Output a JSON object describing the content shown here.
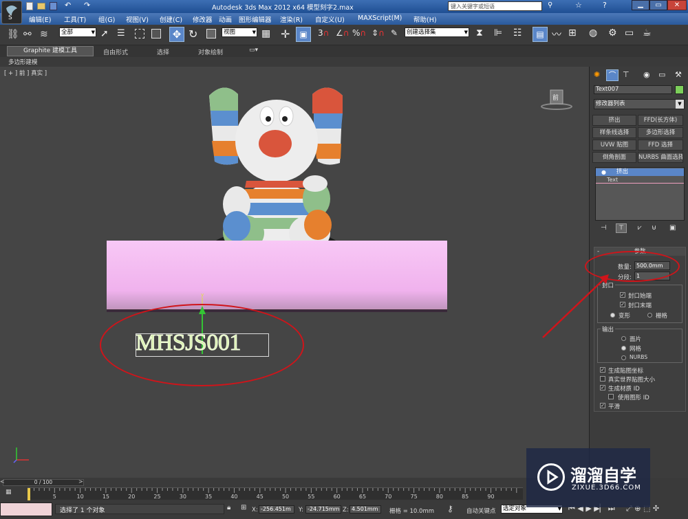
{
  "titlebar": {
    "title": "Autodesk 3ds Max  2012 x64    模型刻字2.max",
    "search_placeholder": "键入关键字或短语"
  },
  "menu": [
    "编辑(E)",
    "工具(T)",
    "组(G)",
    "视图(V)",
    "创建(C)",
    "修改器",
    "动画",
    "图形编辑器",
    "渲染(R)",
    "自定义(U)",
    "MAXScript(M)",
    "帮助(H)"
  ],
  "toolbar": {
    "filter_select": "全部",
    "ref_coord_select": "视图",
    "named_selection": "创建选择集"
  },
  "ribbon": {
    "tabs": [
      "Graphite 建模工具",
      "自由形式",
      "选择",
      "对象绘制"
    ],
    "sub_label": "多边形建模"
  },
  "viewport": {
    "label": "[ + ] 前 ] 真实 ]",
    "text_object": "MHSJS001",
    "gizmo_axis": "y",
    "viewcube_label": "前"
  },
  "panel": {
    "object_name": "Text007",
    "modifier_list": "修改器列表",
    "modifier_buttons": [
      "挤出",
      "FFD(长方体)",
      "样条线选择",
      "多边形选择",
      "UVW 贴图",
      "FFD 选择",
      "倒角剖面",
      "NURBS 曲面选择"
    ],
    "stack": [
      "挤出",
      "Text"
    ],
    "rollout_title": "参数",
    "amount_label": "数量:",
    "amount_value": "500.0mm",
    "segments_label": "分段:",
    "segments_value": "1",
    "capping_label": "封口",
    "cap_start": "封口始端",
    "cap_end": "封口末端",
    "morph": "变形",
    "grid": "栅格",
    "output_label": "输出",
    "output_patch": "面片",
    "output_mesh": "网格",
    "output_nurbs": "NURBS",
    "gen_map_coords": "生成贴图坐标",
    "real_world": "真实世界贴图大小",
    "gen_mat_ids": "生成材质 ID",
    "use_shape_ids": "使用图形 ID",
    "smooth": "平滑"
  },
  "timeline": {
    "frame_counter": "0 / 100",
    "ticks": [
      "0",
      "5",
      "10",
      "15",
      "20",
      "25",
      "30",
      "35",
      "40",
      "45",
      "50",
      "55",
      "60",
      "65",
      "70",
      "75",
      "80",
      "85",
      "90"
    ],
    "status": "选择了 1 个对象",
    "x_label": "X:",
    "x_value": "-256.451m",
    "y_label": "Y:",
    "y_value": "-24.715mm",
    "z_label": "Z:",
    "z_value": "4.501mm",
    "grid_value": "栅格 = 10.0mm",
    "auto_key": "自动关键点",
    "set_key_select": "选定对象"
  },
  "watermark": {
    "brand": "溜溜自学",
    "url": "ZIXUE.3D66.COM"
  },
  "colors": {
    "annotation_red": "#d0141a",
    "tube_pink": "#f4b8f1",
    "accent_blue": "#3d6fb4"
  }
}
